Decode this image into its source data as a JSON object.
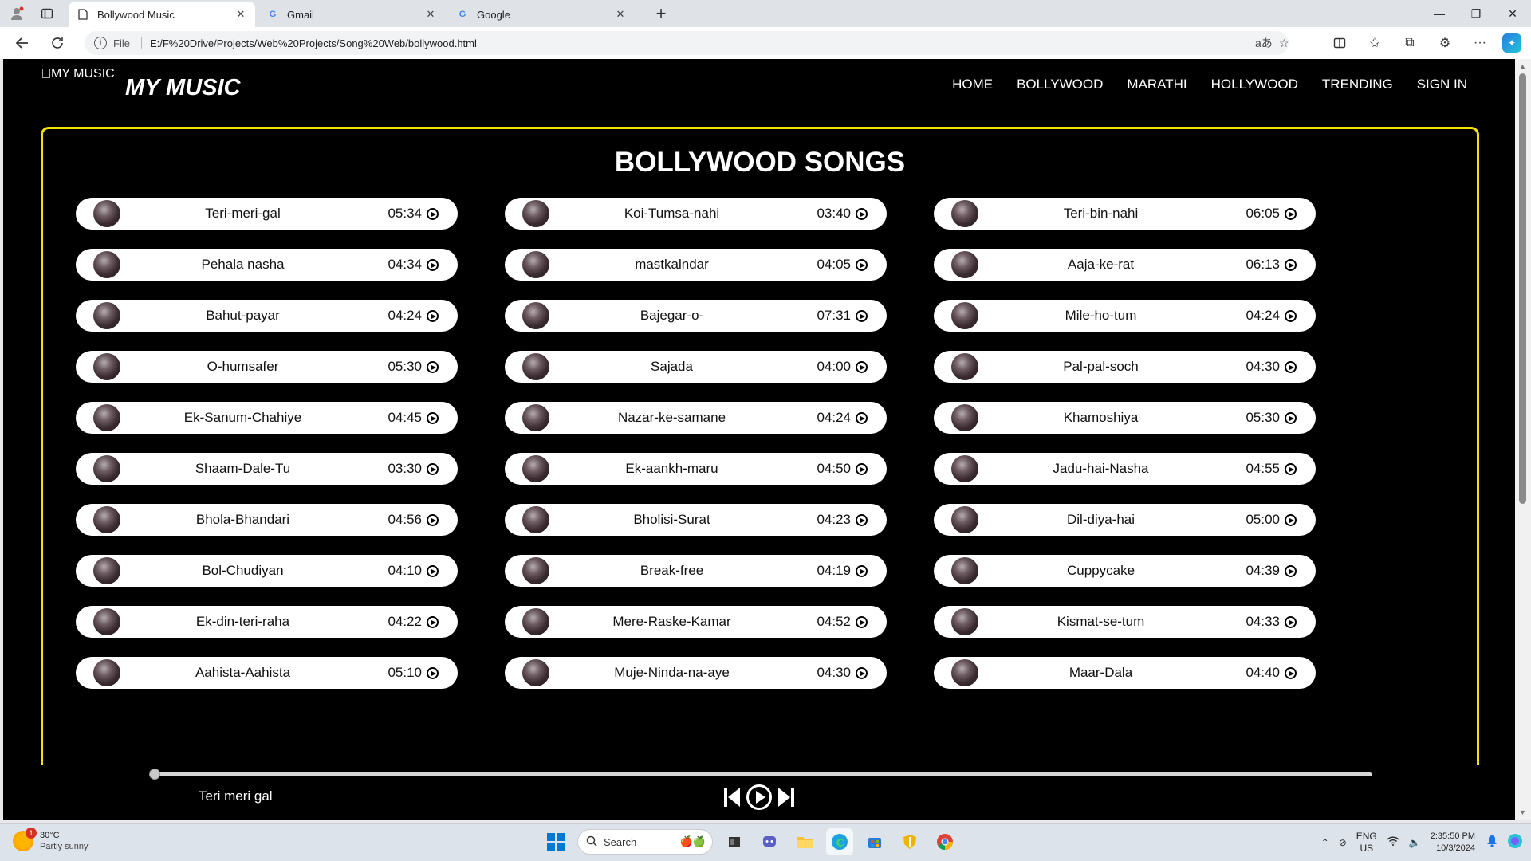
{
  "browser": {
    "tabs": [
      {
        "label": "Bollywood Music",
        "active": true,
        "icon": "page-icon"
      },
      {
        "label": "Gmail",
        "active": false,
        "icon": "google-icon"
      },
      {
        "label": "Google",
        "active": false,
        "icon": "google-icon"
      }
    ],
    "address": {
      "scheme": "File",
      "url": "E:/F%20Drive/Projects/Web%20Projects/Song%20Web/bollywood.html"
    }
  },
  "site": {
    "logo_alt": "MY MUSIC",
    "brand": "MY MUSIC",
    "nav": [
      "HOME",
      "BOLLYWOOD",
      "MARATHI",
      "HOLLYWOOD",
      "TRENDING",
      "SIGN IN"
    ],
    "section_title": "BOLLYWOOD SONGS",
    "accent_color": "#f2e300",
    "songs": [
      {
        "name": "Teri-meri-gal",
        "duration": "05:34"
      },
      {
        "name": "Koi-Tumsa-nahi",
        "duration": "03:40"
      },
      {
        "name": "Teri-bin-nahi",
        "duration": "06:05"
      },
      {
        "name": "Pehala nasha",
        "duration": "04:34"
      },
      {
        "name": "mastkalndar",
        "duration": "04:05"
      },
      {
        "name": "Aaja-ke-rat",
        "duration": "06:13"
      },
      {
        "name": "Bahut-payar",
        "duration": "04:24"
      },
      {
        "name": "Bajegar-o-",
        "duration": "07:31"
      },
      {
        "name": "Mile-ho-tum",
        "duration": "04:24"
      },
      {
        "name": "O-humsafer",
        "duration": "05:30"
      },
      {
        "name": "Sajada",
        "duration": "04:00"
      },
      {
        "name": "Pal-pal-soch",
        "duration": "04:30"
      },
      {
        "name": "Ek-Sanum-Chahiye",
        "duration": "04:45"
      },
      {
        "name": "Nazar-ke-samane",
        "duration": "04:24"
      },
      {
        "name": "Khamoshiya",
        "duration": "05:30"
      },
      {
        "name": "Shaam-Dale-Tu",
        "duration": "03:30"
      },
      {
        "name": "Ek-aankh-maru",
        "duration": "04:50"
      },
      {
        "name": "Jadu-hai-Nasha",
        "duration": "04:55"
      },
      {
        "name": "Bhola-Bhandari",
        "duration": "04:56"
      },
      {
        "name": "Bholisi-Surat",
        "duration": "04:23"
      },
      {
        "name": "Dil-diya-hai",
        "duration": "05:00"
      },
      {
        "name": "Bol-Chudiyan",
        "duration": "04:10"
      },
      {
        "name": "Break-free",
        "duration": "04:19"
      },
      {
        "name": "Cuppycake",
        "duration": "04:39"
      },
      {
        "name": "Ek-din-teri-raha",
        "duration": "04:22"
      },
      {
        "name": "Mere-Raske-Kamar",
        "duration": "04:52"
      },
      {
        "name": "Kismat-se-tum",
        "duration": "04:33"
      },
      {
        "name": "Aahista-Aahista",
        "duration": "05:10"
      },
      {
        "name": "Muje-Ninda-na-aye",
        "duration": "04:30"
      },
      {
        "name": "Maar-Dala",
        "duration": "04:40"
      }
    ],
    "player": {
      "now_playing": "Teri meri gal",
      "progress": 0
    }
  },
  "taskbar": {
    "weather": {
      "temp": "30°C",
      "condition": "Partly sunny",
      "badge": "1"
    },
    "search_placeholder": "Search",
    "tray": {
      "lang": "ENG",
      "region": "US",
      "time": "2:35:50 PM",
      "date": "10/3/2024"
    }
  }
}
